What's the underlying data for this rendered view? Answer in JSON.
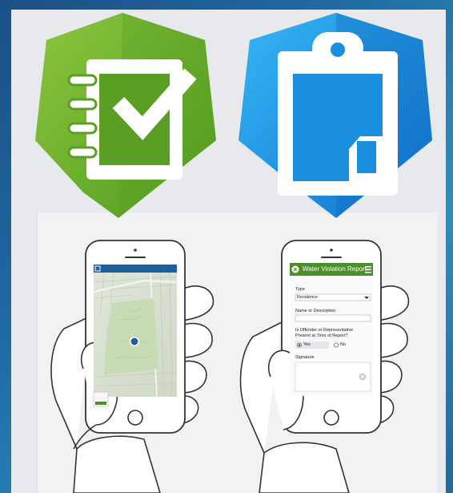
{
  "icons": {
    "survey": {
      "name": "survey123-checklist-icon",
      "color": "#6ab42d"
    },
    "collector": {
      "name": "collector-clipboard-icon",
      "color": "#1a8fe0"
    }
  },
  "phone_right": {
    "header_title": "Water Violation Report",
    "fields": {
      "type_label": "Type",
      "type_value": "Residence",
      "name_label": "Name or Description",
      "offender_label_line1": "Is Offender or Representative",
      "offender_label_line2": "Present at Time of Report?",
      "yes_option": "Yes",
      "no_option": "No",
      "signature_label": "Signature"
    }
  },
  "colors": {
    "map_header": "#1f5f9b",
    "survey_header": "#4a8f2a",
    "location_dot": "#1f5f9b"
  }
}
